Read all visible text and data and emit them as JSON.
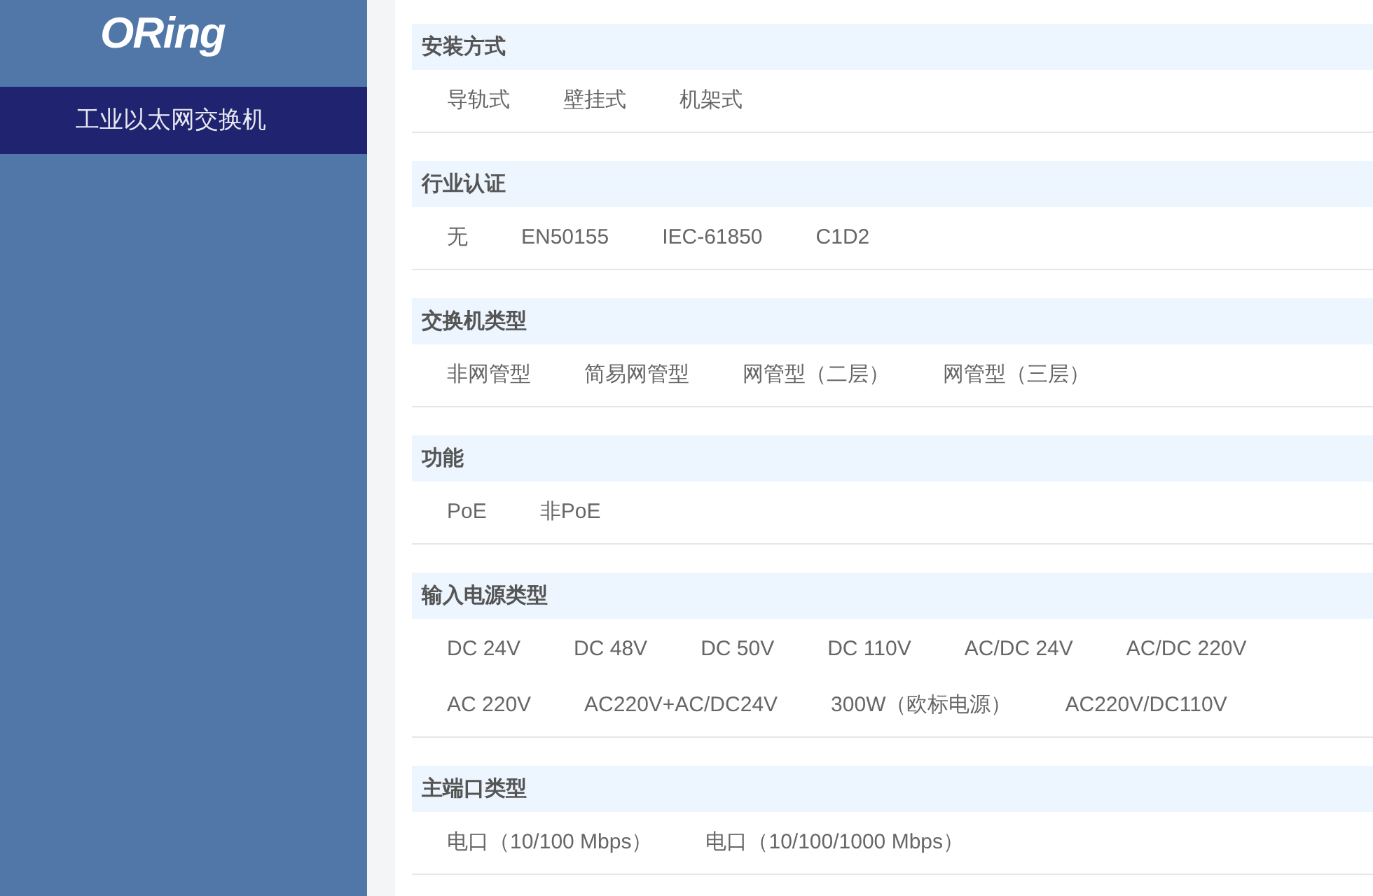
{
  "sidebar": {
    "logo": "ORing",
    "items": [
      {
        "label": "工业以太网交换机",
        "selected": true
      }
    ]
  },
  "filters": [
    {
      "title": "安装方式",
      "options": [
        "导轨式",
        "壁挂式",
        "机架式"
      ]
    },
    {
      "title": "行业认证",
      "options": [
        "无",
        "EN50155",
        "IEC-61850",
        "C1D2"
      ]
    },
    {
      "title": "交换机类型",
      "options": [
        "非网管型",
        "简易网管型",
        "网管型（二层）",
        "网管型（三层）"
      ]
    },
    {
      "title": "功能",
      "options": [
        "PoE",
        "非PoE"
      ]
    },
    {
      "title": "输入电源类型",
      "options": [
        "DC 24V",
        "DC 48V",
        "DC 50V",
        "DC 110V",
        "AC/DC 24V",
        "AC/DC 220V",
        "AC 220V",
        "AC220V+AC/DC24V",
        "300W（欧标电源）",
        "AC220V/DC110V"
      ]
    },
    {
      "title": "主端口类型",
      "options": [
        "电口（10/100 Mbps）",
        "电口（10/100/1000 Mbps）"
      ]
    }
  ]
}
